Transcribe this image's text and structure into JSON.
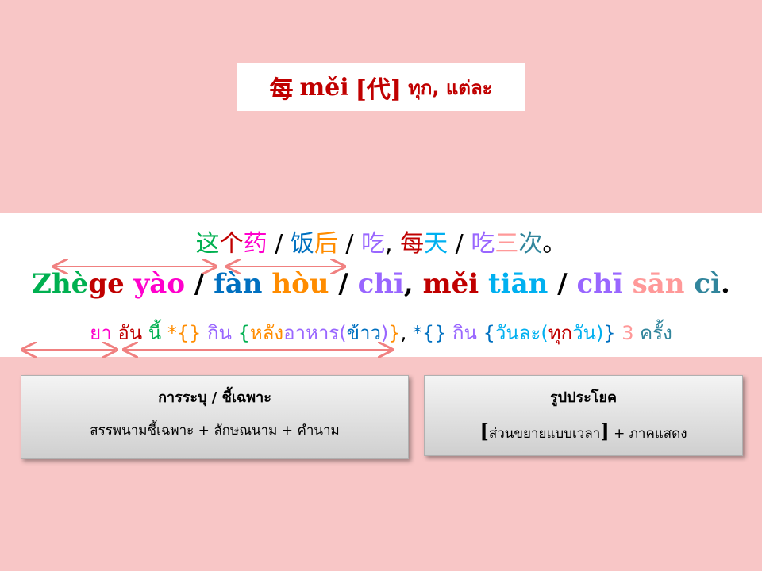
{
  "title": {
    "hanzi": "每",
    "pinyin": "měi",
    "pos": "[代]",
    "thai": "ทุก, แต่ละ"
  },
  "sentence": {
    "hanzi": [
      {
        "text": "这",
        "color": "#00b050"
      },
      {
        "text": "个",
        "color": "#c00000"
      },
      {
        "text": "药",
        "color": "#ff00cc"
      },
      {
        "text": " / ",
        "color": "#000000"
      },
      {
        "text": "饭",
        "color": "#0070c0"
      },
      {
        "text": "后",
        "color": "#ff8c00"
      },
      {
        "text": " / ",
        "color": "#000000"
      },
      {
        "text": "吃",
        "color": "#9966ff"
      },
      {
        "text": ", ",
        "color": "#000000"
      },
      {
        "text": "每",
        "color": "#c00000"
      },
      {
        "text": "天",
        "color": "#00b0f0"
      },
      {
        "text": " / ",
        "color": "#000000"
      },
      {
        "text": "吃",
        "color": "#9966ff"
      },
      {
        "text": "三",
        "color": "#ff9999"
      },
      {
        "text": "次",
        "color": "#31859c"
      },
      {
        "text": "。",
        "color": "#000000"
      }
    ],
    "pinyin": [
      {
        "text": "Zhè",
        "color": "#00b050"
      },
      {
        "text": "ge",
        "color": "#c00000"
      },
      {
        "text": " yào",
        "color": "#ff00cc"
      },
      {
        "text": " / ",
        "color": "#000000"
      },
      {
        "text": "fàn",
        "color": "#0070c0"
      },
      {
        "text": " hòu",
        "color": "#ff8c00"
      },
      {
        "text": " / ",
        "color": "#000000"
      },
      {
        "text": "chī",
        "color": "#9966ff"
      },
      {
        "text": ", ",
        "color": "#000000"
      },
      {
        "text": "měi",
        "color": "#c00000"
      },
      {
        "text": " tiān",
        "color": "#00b0f0"
      },
      {
        "text": " / ",
        "color": "#000000"
      },
      {
        "text": "chī",
        "color": "#9966ff"
      },
      {
        "text": " sān",
        "color": "#ff9999"
      },
      {
        "text": " cì",
        "color": "#31859c"
      },
      {
        "text": ".",
        "color": "#000000"
      }
    ],
    "thai": [
      {
        "text": "ยา ",
        "color": "#ff00cc"
      },
      {
        "text": "อัน ",
        "color": "#c00000"
      },
      {
        "text": "นี้ ",
        "color": "#00b050"
      },
      {
        "text": "*{} ",
        "color": "#ff8c00"
      },
      {
        "text": "กิน ",
        "color": "#9966ff"
      },
      {
        "text": "{",
        "color": "#00b050"
      },
      {
        "text": "หลัง",
        "color": "#ff8c00"
      },
      {
        "text": "อาหาร(",
        "color": "#9966ff"
      },
      {
        "text": "ข้าว",
        "color": "#0070c0"
      },
      {
        "text": ")",
        "color": "#9966ff"
      },
      {
        "text": "}",
        "color": "#ff8c00"
      },
      {
        "text": ", ",
        "color": "#000000"
      },
      {
        "text": "*{} ",
        "color": "#0070c0"
      },
      {
        "text": "กิน ",
        "color": "#9966ff"
      },
      {
        "text": "{",
        "color": "#0070c0"
      },
      {
        "text": "วันละ(",
        "color": "#00b0f0"
      },
      {
        "text": "ทุก",
        "color": "#c00000"
      },
      {
        "text": "วัน",
        "color": "#00b0f0"
      },
      {
        "text": ")",
        "color": "#00b0f0"
      },
      {
        "text": "} ",
        "color": "#0070c0"
      },
      {
        "text": "3 ",
        "color": "#ff9999"
      },
      {
        "text": "ครั้ง",
        "color": "#31859c"
      }
    ]
  },
  "boxes": {
    "left": {
      "heading": "การระบุ / ชี้เฉพาะ",
      "body": "สรรพนามชี้เฉพาะ + ลักษณนาม + คำนาม"
    },
    "right": {
      "heading": "รูปประโยค",
      "body_open": "[",
      "body_mid": "ส่วนขยายแบบเวลา",
      "body_close": "]",
      "body_tail": " + ภาคแสดง"
    }
  },
  "colors": {
    "background": "#f8c6c6",
    "arrow": "#f08080",
    "title_red": "#c00000"
  }
}
